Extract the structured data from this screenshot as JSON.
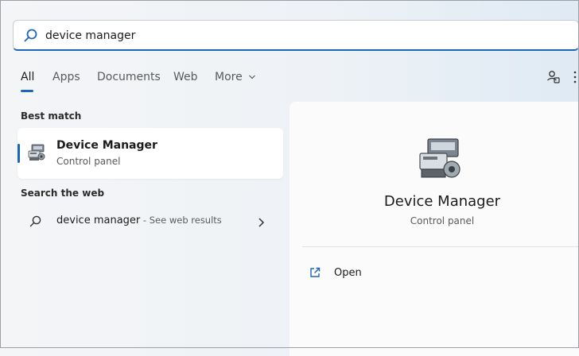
{
  "search": {
    "query": "device manager"
  },
  "tabs": [
    {
      "label": "All"
    },
    {
      "label": "Apps"
    },
    {
      "label": "Documents"
    },
    {
      "label": "Web"
    },
    {
      "label": "More"
    }
  ],
  "best_match": {
    "section_label": "Best match",
    "title": "Device Manager",
    "subtitle": "Control panel"
  },
  "web": {
    "section_label": "Search the web",
    "query": "device manager",
    "hint": " - See web results"
  },
  "detail": {
    "title": "Device Manager",
    "subtitle": "Control panel",
    "actions": [
      {
        "label": "Open",
        "icon": "open-external-icon"
      }
    ]
  },
  "colors": {
    "accent": "#1a66b8",
    "arrow": "#e0141c"
  }
}
